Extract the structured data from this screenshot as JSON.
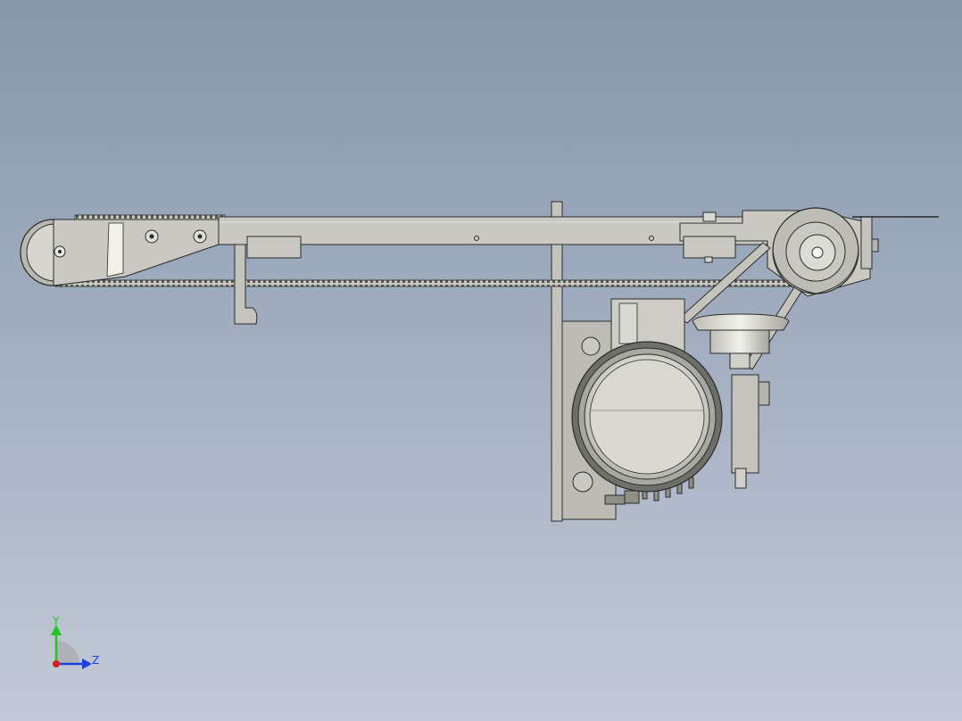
{
  "triad": {
    "y_label": "Y",
    "z_label": "Z",
    "y_color": "#22c722",
    "z_color": "#1f3fe0",
    "origin_color": "#d62020"
  },
  "colors": {
    "part_fill": "#c9c9c1",
    "part_fill_light": "#deded8",
    "part_shade": "#9d9d95",
    "edge": "#2a2a2a",
    "belt": "#3a3a3a"
  }
}
